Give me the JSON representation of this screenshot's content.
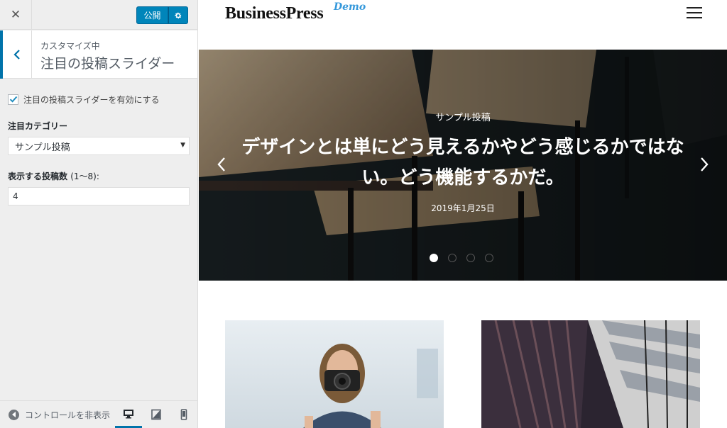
{
  "sidebar": {
    "publish_label": "公開",
    "crumb": "カスタマイズ中",
    "section_title": "注目の投稿スライダー",
    "enable_slider_label": "注目の投稿スライダーを有効にする",
    "enable_slider_checked": true,
    "category_label": "注目カテゴリー",
    "category_value": "サンプル投稿",
    "count_label": "表示する投稿数",
    "count_hint": "(1〜8):",
    "count_value": "4",
    "hide_controls_label": "コントロールを非表示",
    "devices": [
      "desktop",
      "tablet",
      "mobile"
    ],
    "active_device": "desktop"
  },
  "site": {
    "logo_text": "BusinessPress",
    "logo_badge": "Demo"
  },
  "slider": {
    "category": "サンプル投稿",
    "title": "デザインとは単にどう見えるかやどう感じるかではない。どう機能するかだ。",
    "date": "2019年1月25日",
    "slide_count": 4,
    "active_slide": 1
  },
  "colors": {
    "accent": "#0085ba",
    "logo_badge": "#3498db"
  }
}
